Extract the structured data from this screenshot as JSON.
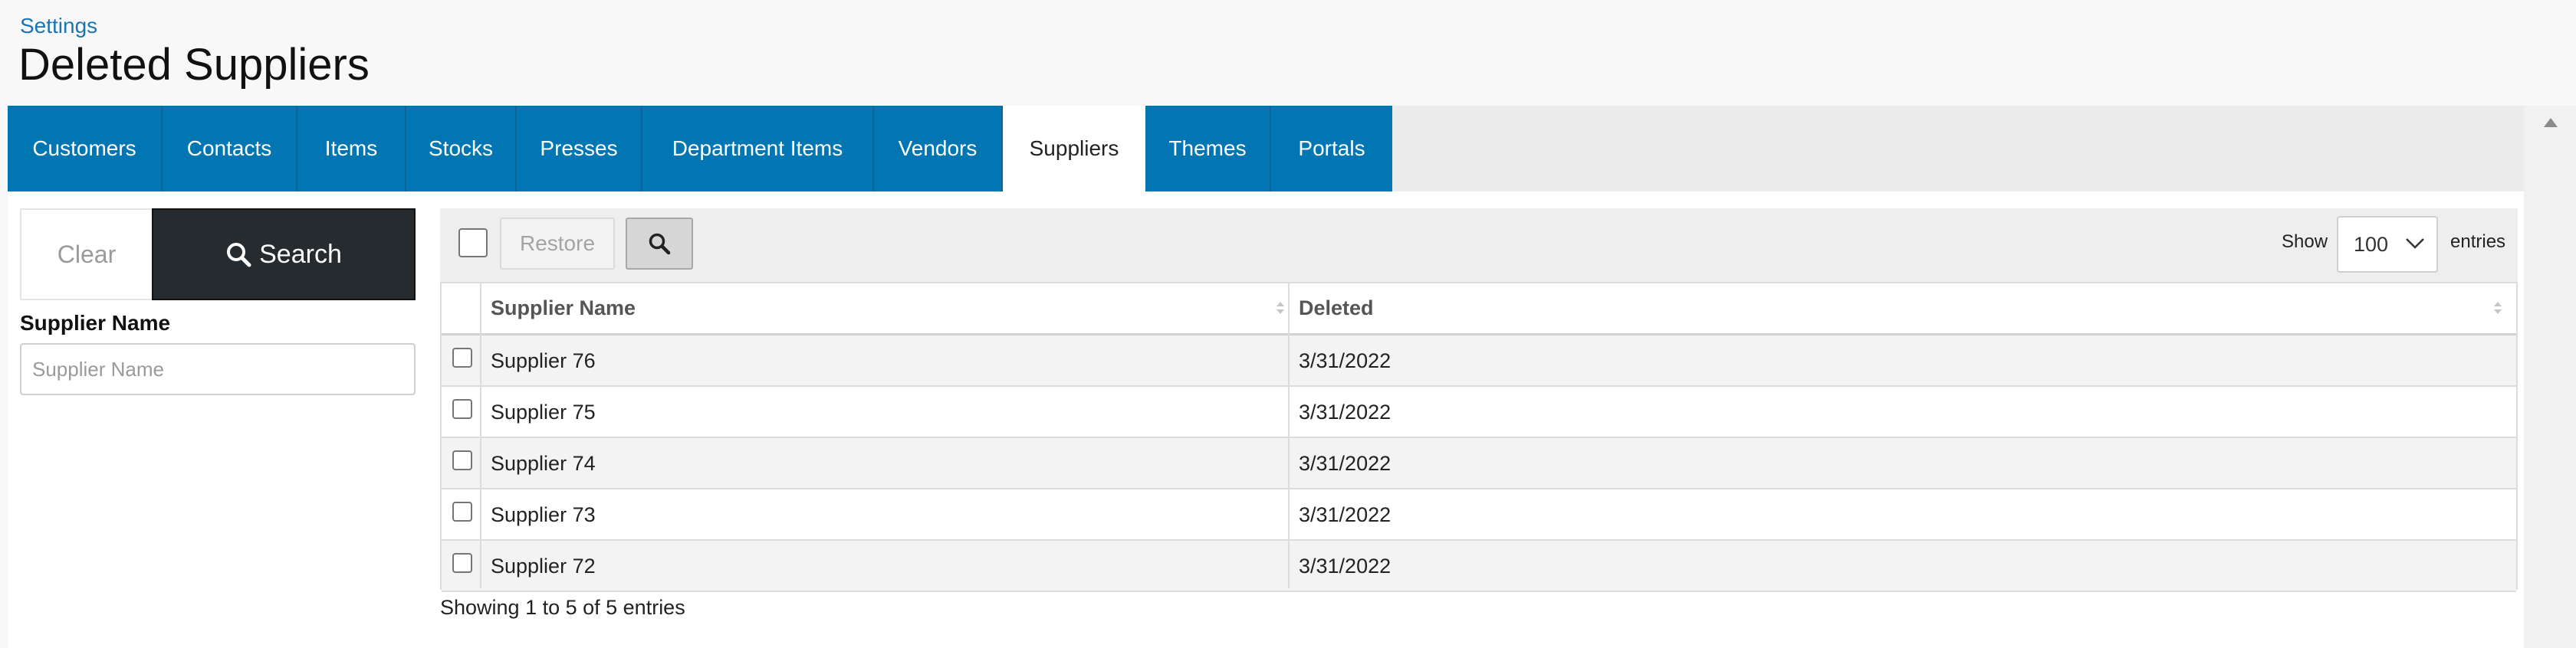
{
  "header": {
    "breadcrumb": "Settings",
    "title": "Deleted Suppliers"
  },
  "tabs": [
    {
      "label": "Customers",
      "active": false
    },
    {
      "label": "Contacts",
      "active": false
    },
    {
      "label": "Items",
      "active": false
    },
    {
      "label": "Stocks",
      "active": false
    },
    {
      "label": "Presses",
      "active": false
    },
    {
      "label": "Department Items",
      "active": false
    },
    {
      "label": "Vendors",
      "active": false
    },
    {
      "label": "Suppliers",
      "active": true
    },
    {
      "label": "Themes",
      "active": false
    },
    {
      "label": "Portals",
      "active": false
    }
  ],
  "filter": {
    "clear_label": "Clear",
    "search_label": "Search",
    "supplier_name_label": "Supplier Name",
    "supplier_name_placeholder": "Supplier Name",
    "supplier_name_value": ""
  },
  "grid": {
    "restore_label": "Restore",
    "show_label": "Show",
    "page_size": "100",
    "entries_label": "entries",
    "columns": [
      "Supplier Name",
      "Deleted"
    ],
    "rows": [
      {
        "name": "Supplier 76",
        "deleted": "3/31/2022"
      },
      {
        "name": "Supplier 75",
        "deleted": "3/31/2022"
      },
      {
        "name": "Supplier 74",
        "deleted": "3/31/2022"
      },
      {
        "name": "Supplier 73",
        "deleted": "3/31/2022"
      },
      {
        "name": "Supplier 72",
        "deleted": "3/31/2022"
      }
    ],
    "info": "Showing 1 to 5 of 5 entries"
  },
  "colors": {
    "tab_bg": "#0276b2",
    "link": "#1a75b4",
    "search_button_bg": "#262b2f"
  },
  "icons": {
    "search": "magnifier-icon",
    "sort": "sort-both-icon",
    "dropdown": "chevron-down-icon",
    "scroll_up": "triangle-up-icon"
  }
}
